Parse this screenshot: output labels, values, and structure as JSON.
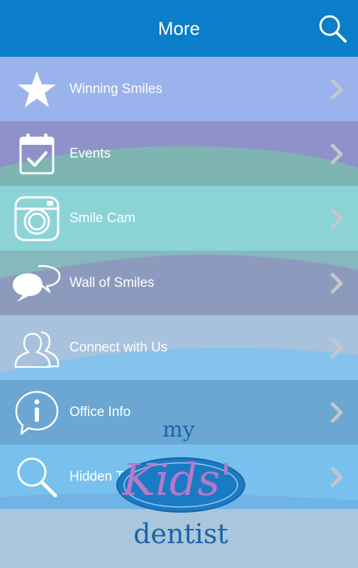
{
  "header": {
    "title": "More"
  },
  "menu": [
    {
      "label": "Winning Smiles",
      "icon": "star-icon",
      "color": "#9bb3ec"
    },
    {
      "label": "Events",
      "icon": "calendar-check-icon",
      "color": "#8e92c9"
    },
    {
      "label": "Smile Cam",
      "icon": "camera-icon",
      "color": "#8cd3d6"
    },
    {
      "label": "Wall of Smiles",
      "icon": "chat-bubbles-icon",
      "color": "#8c9bbd"
    },
    {
      "label": "Connect with Us",
      "icon": "users-icon",
      "color": "#a8c2dd"
    },
    {
      "label": "Office Info",
      "icon": "info-icon",
      "color": "#6ba7d2"
    },
    {
      "label": "Hidden Toothbrushes",
      "icon": "magnifier-icon",
      "color": "#78c1ef"
    }
  ],
  "logo": {
    "line1": "my",
    "line2": "Kids'",
    "line3": "dentist"
  },
  "colors": {
    "header": "#0a7ec8",
    "chevron": "#c3c6cc"
  }
}
